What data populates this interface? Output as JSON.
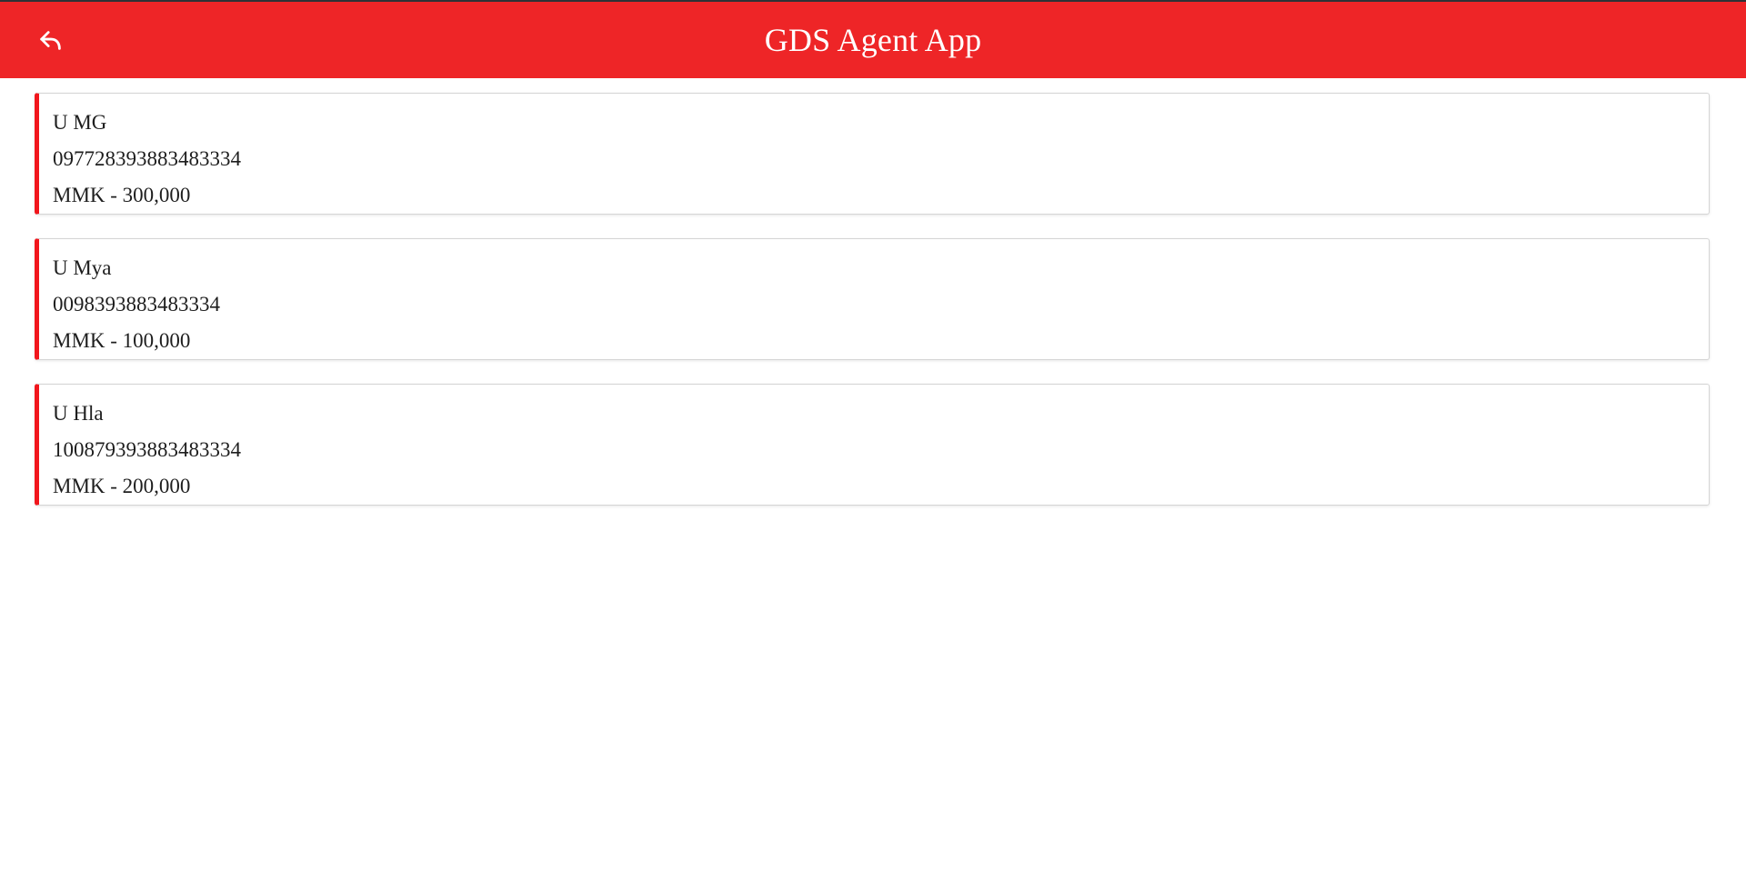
{
  "header": {
    "title": "GDS Agent App",
    "back_icon": "reply-arrow-icon",
    "background_color": "#ee2527"
  },
  "accounts": [
    {
      "name": "U MG",
      "number": "097728393883483334",
      "amount": "MMK - 300,000"
    },
    {
      "name": "U Mya",
      "number": "0098393883483334",
      "amount": "MMK - 100,000"
    },
    {
      "name": "U Hla",
      "number": "100879393883483334",
      "amount": "MMK - 200,000"
    }
  ],
  "colors": {
    "accent": "#f1161c",
    "text": "#1e1e1e"
  }
}
